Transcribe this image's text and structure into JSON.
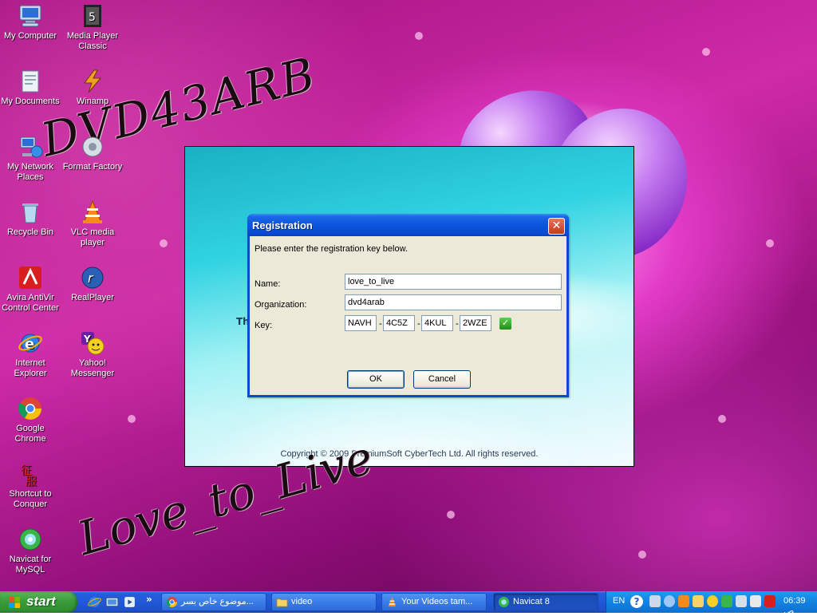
{
  "desktop": {
    "overlay_texts": {
      "top": "DVD43ARB",
      "bottom": "Love_to_Live"
    },
    "icons": [
      {
        "label": "My Computer",
        "icon": "my-computer-icon"
      },
      {
        "label": "Media Player Classic",
        "icon": "media-player-classic-icon"
      },
      {
        "label": "My Documents",
        "icon": "my-documents-icon"
      },
      {
        "label": "Winamp",
        "icon": "winamp-icon"
      },
      {
        "label": "My Network Places",
        "icon": "network-places-icon"
      },
      {
        "label": "Format Factory",
        "icon": "format-factory-icon"
      },
      {
        "label": "Recycle Bin",
        "icon": "recycle-bin-icon"
      },
      {
        "label": "VLC media player",
        "icon": "vlc-icon"
      },
      {
        "label": "Avira AntiVir Control Center",
        "icon": "avira-icon"
      },
      {
        "label": "RealPlayer",
        "icon": "realplayer-icon"
      },
      {
        "label": "Internet Explorer",
        "icon": "internet-explorer-icon"
      },
      {
        "label": "Yahoo! Messenger",
        "icon": "yahoo-messenger-icon"
      },
      {
        "label": "Google Chrome",
        "icon": "chrome-icon"
      },
      {
        "label": "Shortcut to Conquer",
        "icon": "conquer-icon"
      },
      {
        "label": "Navicat for MySQL",
        "icon": "navicat-icon"
      }
    ]
  },
  "splash": {
    "partial_text": "Th",
    "copyright": "Copyright © 2009 PremiumSoft CyberTech Ltd. All rights reserved."
  },
  "dialog": {
    "title": "Registration",
    "message": "Please enter the registration key below.",
    "name_label": "Name:",
    "name_value": "love_to_live",
    "org_label": "Organization:",
    "org_value": "dvd4arab",
    "key_label": "Key:",
    "key_parts": [
      "NAVH",
      "4C5Z",
      "4KUL",
      "2WZE"
    ],
    "key_separator": "-",
    "close_glyph": "✕",
    "check_glyph": "✓",
    "ok_label": "OK",
    "cancel_label": "Cancel"
  },
  "taskbar": {
    "start_label": "start",
    "more_glyph": "»",
    "tasks": [
      {
        "label": "موضوع خاص بسر...",
        "icon": "chrome-icon",
        "active": false
      },
      {
        "label": "video",
        "icon": "folder-icon",
        "active": false
      },
      {
        "label": "Your Videos tam...",
        "icon": "vlc-icon",
        "active": false
      },
      {
        "label": "Navicat 8",
        "icon": "navicat-icon",
        "active": true
      }
    ],
    "tray": {
      "language": "EN",
      "help_glyph": "?",
      "clock": "06:39 ص"
    }
  },
  "colors": {
    "taskbar_blue": "#245edc",
    "start_green": "#3a9d3a",
    "dialog_title_blue": "#0a55dd",
    "dialog_body": "#ece9d8",
    "close_red": "#c6391c"
  }
}
